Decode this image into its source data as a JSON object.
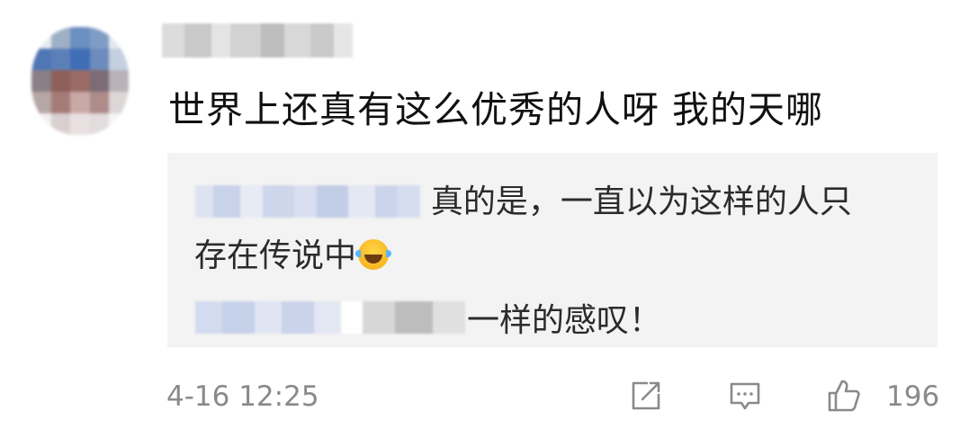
{
  "comment": {
    "text": "世界上还真有这么优秀的人呀 我的天哪"
  },
  "reply": {
    "line1": ". 真的是，一直以为这样的人只",
    "line2": "存在传说中",
    "emoji": "laughing-with-tears-emoji",
    "line3": "一样的感叹！"
  },
  "footer": {
    "timestamp": "4-16 12:25",
    "like_count": "196",
    "icons": [
      "share-icon",
      "comment-icon",
      "like-icon"
    ]
  },
  "colors": {
    "reply_background": "#f3f3f3",
    "meta_text": "#8a8a8a",
    "icon_stroke": "#8a8a8a"
  }
}
